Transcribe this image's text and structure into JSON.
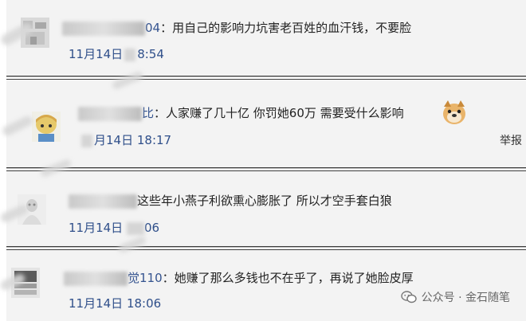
{
  "comments": [
    {
      "name_visible": "04",
      "text": "：用自己的影响力坑害老百姓的血汗钱，不要脸",
      "date": "11月14日",
      "time_visible": "8:54"
    },
    {
      "name_visible": "比",
      "text": "：人家赚了几十亿 你罚她60万 需要受什么影响",
      "emoji": "doge-emoji",
      "date_visible": "月14日",
      "time": "18:17",
      "report_label": "举报"
    },
    {
      "name_visible": "",
      "text": "这些年小燕子利欲熏心膨胀了 所以才空手套白狼",
      "date": "11月14日",
      "time_visible": "06"
    },
    {
      "name_visible": "觉110",
      "text": "：她赚了那么多钱也不在乎了，再说了她脸皮厚",
      "date": "11月14日",
      "time": "18:06"
    }
  ],
  "watermark": {
    "label": "公众号 · 金石随笔"
  },
  "colors": {
    "row_bg": "#f3f3f3",
    "divider": "#3a3a3a",
    "username": "#34538f",
    "timestamp": "#2f4f8a"
  }
}
